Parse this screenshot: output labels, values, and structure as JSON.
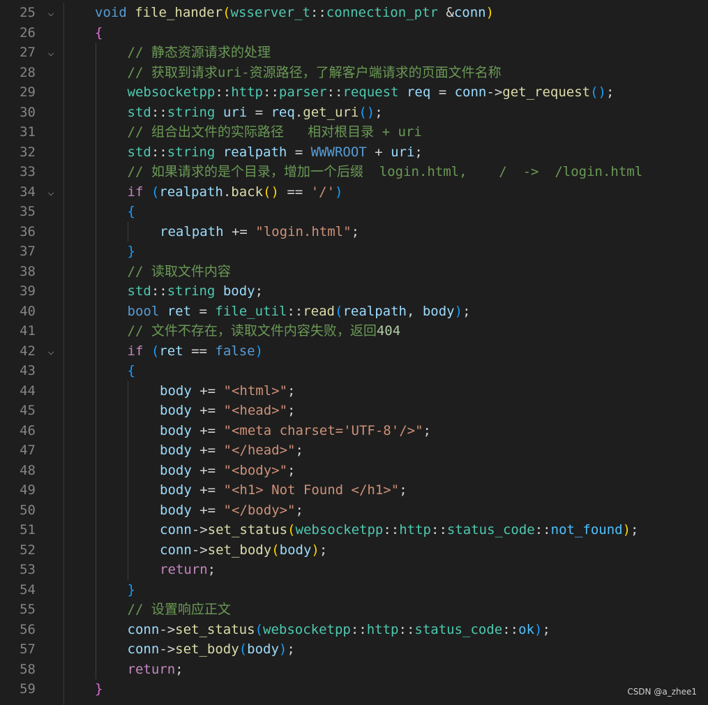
{
  "watermark": "CSDN @a_zhee1",
  "lines": [
    {
      "n": "25",
      "fold": true,
      "indent": 1,
      "tokens": [
        [
          "keyword",
          "void"
        ],
        [
          "op",
          " "
        ],
        [
          "func",
          "file_hander"
        ],
        [
          "brace1",
          "("
        ],
        [
          "ns",
          "wsserver_t"
        ],
        [
          "op",
          "::"
        ],
        [
          "type",
          "connection_ptr"
        ],
        [
          "op",
          " "
        ],
        [
          "op",
          "&"
        ],
        [
          "var",
          "conn"
        ],
        [
          "brace1",
          ")"
        ]
      ]
    },
    {
      "n": "26",
      "fold": false,
      "indent": 1,
      "tokens": [
        [
          "brace2",
          "{"
        ]
      ]
    },
    {
      "n": "27",
      "fold": true,
      "indent": 2,
      "tokens": [
        [
          "comment",
          "// 静态资源请求的处理"
        ]
      ]
    },
    {
      "n": "28",
      "fold": false,
      "indent": 2,
      "tokens": [
        [
          "comment",
          "// 获取到请求uri-资源路径，了解客户端请求的页面文件名称"
        ]
      ]
    },
    {
      "n": "29",
      "fold": false,
      "indent": 2,
      "tokens": [
        [
          "ns",
          "websocketpp"
        ],
        [
          "op",
          "::"
        ],
        [
          "ns",
          "http"
        ],
        [
          "op",
          "::"
        ],
        [
          "ns",
          "parser"
        ],
        [
          "op",
          "::"
        ],
        [
          "type",
          "request"
        ],
        [
          "op",
          " "
        ],
        [
          "var",
          "req"
        ],
        [
          "op",
          " = "
        ],
        [
          "var",
          "conn"
        ],
        [
          "op",
          "->"
        ],
        [
          "func",
          "get_request"
        ],
        [
          "brace3",
          "()"
        ],
        [
          "punct",
          ";"
        ]
      ]
    },
    {
      "n": "30",
      "fold": false,
      "indent": 2,
      "tokens": [
        [
          "ns",
          "std"
        ],
        [
          "op",
          "::"
        ],
        [
          "type",
          "string"
        ],
        [
          "op",
          " "
        ],
        [
          "var",
          "uri"
        ],
        [
          "op",
          " = "
        ],
        [
          "var",
          "req"
        ],
        [
          "op",
          "."
        ],
        [
          "func",
          "get_uri"
        ],
        [
          "brace3",
          "()"
        ],
        [
          "punct",
          ";"
        ]
      ]
    },
    {
      "n": "31",
      "fold": false,
      "indent": 2,
      "tokens": [
        [
          "comment",
          "// 组合出文件的实际路径   相对根目录 + uri"
        ]
      ]
    },
    {
      "n": "32",
      "fold": false,
      "indent": 2,
      "tokens": [
        [
          "ns",
          "std"
        ],
        [
          "op",
          "::"
        ],
        [
          "type",
          "string"
        ],
        [
          "op",
          " "
        ],
        [
          "var",
          "realpath"
        ],
        [
          "op",
          " = "
        ],
        [
          "macro",
          "WWWROOT"
        ],
        [
          "op",
          " + "
        ],
        [
          "var",
          "uri"
        ],
        [
          "punct",
          ";"
        ]
      ]
    },
    {
      "n": "33",
      "fold": false,
      "indent": 2,
      "tokens": [
        [
          "comment",
          "// 如果请求的是个目录，增加一个后缀  login.html,    /  ->  /login.html"
        ]
      ]
    },
    {
      "n": "34",
      "fold": true,
      "indent": 2,
      "tokens": [
        [
          "control",
          "if"
        ],
        [
          "op",
          " "
        ],
        [
          "brace3",
          "("
        ],
        [
          "var",
          "realpath"
        ],
        [
          "op",
          "."
        ],
        [
          "func",
          "back"
        ],
        [
          "brace1",
          "()"
        ],
        [
          "op",
          " == "
        ],
        [
          "string",
          "'/'"
        ],
        [
          "brace3",
          ")"
        ]
      ]
    },
    {
      "n": "35",
      "fold": false,
      "indent": 2,
      "tokens": [
        [
          "brace3",
          "{"
        ]
      ]
    },
    {
      "n": "36",
      "fold": false,
      "indent": 3,
      "tokens": [
        [
          "var",
          "realpath"
        ],
        [
          "op",
          " += "
        ],
        [
          "string",
          "\"login.html\""
        ],
        [
          "punct",
          ";"
        ]
      ]
    },
    {
      "n": "37",
      "fold": false,
      "indent": 2,
      "tokens": [
        [
          "brace3",
          "}"
        ]
      ]
    },
    {
      "n": "38",
      "fold": false,
      "indent": 2,
      "tokens": [
        [
          "comment",
          "// 读取文件内容"
        ]
      ]
    },
    {
      "n": "39",
      "fold": false,
      "indent": 2,
      "tokens": [
        [
          "ns",
          "std"
        ],
        [
          "op",
          "::"
        ],
        [
          "type",
          "string"
        ],
        [
          "op",
          " "
        ],
        [
          "var",
          "body"
        ],
        [
          "punct",
          ";"
        ]
      ]
    },
    {
      "n": "40",
      "fold": false,
      "indent": 2,
      "tokens": [
        [
          "keyword",
          "bool"
        ],
        [
          "op",
          " "
        ],
        [
          "var",
          "ret"
        ],
        [
          "op",
          " = "
        ],
        [
          "ns",
          "file_util"
        ],
        [
          "op",
          "::"
        ],
        [
          "func",
          "read"
        ],
        [
          "brace3",
          "("
        ],
        [
          "var",
          "realpath"
        ],
        [
          "punct",
          ", "
        ],
        [
          "var",
          "body"
        ],
        [
          "brace3",
          ")"
        ],
        [
          "punct",
          ";"
        ]
      ]
    },
    {
      "n": "41",
      "fold": false,
      "indent": 2,
      "tokens": [
        [
          "comment",
          "// 文件不存在，读取文件内容失败，返回"
        ],
        [
          "number",
          "404"
        ]
      ]
    },
    {
      "n": "42",
      "fold": true,
      "indent": 2,
      "tokens": [
        [
          "control",
          "if"
        ],
        [
          "op",
          " "
        ],
        [
          "brace3",
          "("
        ],
        [
          "var",
          "ret"
        ],
        [
          "op",
          " == "
        ],
        [
          "bool",
          "false"
        ],
        [
          "brace3",
          ")"
        ]
      ]
    },
    {
      "n": "43",
      "fold": false,
      "indent": 2,
      "tokens": [
        [
          "brace3",
          "{"
        ]
      ]
    },
    {
      "n": "44",
      "fold": false,
      "indent": 3,
      "tokens": [
        [
          "var",
          "body"
        ],
        [
          "op",
          " += "
        ],
        [
          "string",
          "\"<html>\""
        ],
        [
          "punct",
          ";"
        ]
      ]
    },
    {
      "n": "45",
      "fold": false,
      "indent": 3,
      "tokens": [
        [
          "var",
          "body"
        ],
        [
          "op",
          " += "
        ],
        [
          "string",
          "\"<head>\""
        ],
        [
          "punct",
          ";"
        ]
      ]
    },
    {
      "n": "46",
      "fold": false,
      "indent": 3,
      "tokens": [
        [
          "var",
          "body"
        ],
        [
          "op",
          " += "
        ],
        [
          "string",
          "\"<meta charset='UTF-8'/>\""
        ],
        [
          "punct",
          ";"
        ]
      ]
    },
    {
      "n": "47",
      "fold": false,
      "indent": 3,
      "tokens": [
        [
          "var",
          "body"
        ],
        [
          "op",
          " += "
        ],
        [
          "string",
          "\"</head>\""
        ],
        [
          "punct",
          ";"
        ]
      ]
    },
    {
      "n": "48",
      "fold": false,
      "indent": 3,
      "tokens": [
        [
          "var",
          "body"
        ],
        [
          "op",
          " += "
        ],
        [
          "string",
          "\"<body>\""
        ],
        [
          "punct",
          ";"
        ]
      ]
    },
    {
      "n": "49",
      "fold": false,
      "indent": 3,
      "tokens": [
        [
          "var",
          "body"
        ],
        [
          "op",
          " += "
        ],
        [
          "string",
          "\"<h1> Not Found </h1>\""
        ],
        [
          "punct",
          ";"
        ]
      ]
    },
    {
      "n": "50",
      "fold": false,
      "indent": 3,
      "tokens": [
        [
          "var",
          "body"
        ],
        [
          "op",
          " += "
        ],
        [
          "string",
          "\"</body>\""
        ],
        [
          "punct",
          ";"
        ]
      ]
    },
    {
      "n": "51",
      "fold": false,
      "indent": 3,
      "tokens": [
        [
          "var",
          "conn"
        ],
        [
          "op",
          "->"
        ],
        [
          "func",
          "set_status"
        ],
        [
          "brace1",
          "("
        ],
        [
          "ns",
          "websocketpp"
        ],
        [
          "op",
          "::"
        ],
        [
          "ns",
          "http"
        ],
        [
          "op",
          "::"
        ],
        [
          "ns",
          "status_code"
        ],
        [
          "op",
          "::"
        ],
        [
          "enum",
          "not_found"
        ],
        [
          "brace1",
          ")"
        ],
        [
          "punct",
          ";"
        ]
      ]
    },
    {
      "n": "52",
      "fold": false,
      "indent": 3,
      "tokens": [
        [
          "var",
          "conn"
        ],
        [
          "op",
          "->"
        ],
        [
          "func",
          "set_body"
        ],
        [
          "brace1",
          "("
        ],
        [
          "var",
          "body"
        ],
        [
          "brace1",
          ")"
        ],
        [
          "punct",
          ";"
        ]
      ]
    },
    {
      "n": "53",
      "fold": false,
      "indent": 3,
      "tokens": [
        [
          "control",
          "return"
        ],
        [
          "punct",
          ";"
        ]
      ]
    },
    {
      "n": "54",
      "fold": false,
      "indent": 2,
      "tokens": [
        [
          "brace3",
          "}"
        ]
      ]
    },
    {
      "n": "55",
      "fold": false,
      "indent": 2,
      "tokens": [
        [
          "comment",
          "// 设置响应正文"
        ]
      ]
    },
    {
      "n": "56",
      "fold": false,
      "indent": 2,
      "tokens": [
        [
          "var",
          "conn"
        ],
        [
          "op",
          "->"
        ],
        [
          "func",
          "set_status"
        ],
        [
          "brace3",
          "("
        ],
        [
          "ns",
          "websocketpp"
        ],
        [
          "op",
          "::"
        ],
        [
          "ns",
          "http"
        ],
        [
          "op",
          "::"
        ],
        [
          "ns",
          "status_code"
        ],
        [
          "op",
          "::"
        ],
        [
          "enum",
          "ok"
        ],
        [
          "brace3",
          ")"
        ],
        [
          "punct",
          ";"
        ]
      ]
    },
    {
      "n": "57",
      "fold": false,
      "indent": 2,
      "tokens": [
        [
          "var",
          "conn"
        ],
        [
          "op",
          "->"
        ],
        [
          "func",
          "set_body"
        ],
        [
          "brace3",
          "("
        ],
        [
          "var",
          "body"
        ],
        [
          "brace3",
          ")"
        ],
        [
          "punct",
          ";"
        ]
      ]
    },
    {
      "n": "58",
      "fold": false,
      "indent": 2,
      "tokens": [
        [
          "control",
          "return"
        ],
        [
          "punct",
          ";"
        ]
      ]
    },
    {
      "n": "59",
      "fold": false,
      "indent": 1,
      "tokens": [
        [
          "brace2",
          "}"
        ]
      ]
    }
  ]
}
